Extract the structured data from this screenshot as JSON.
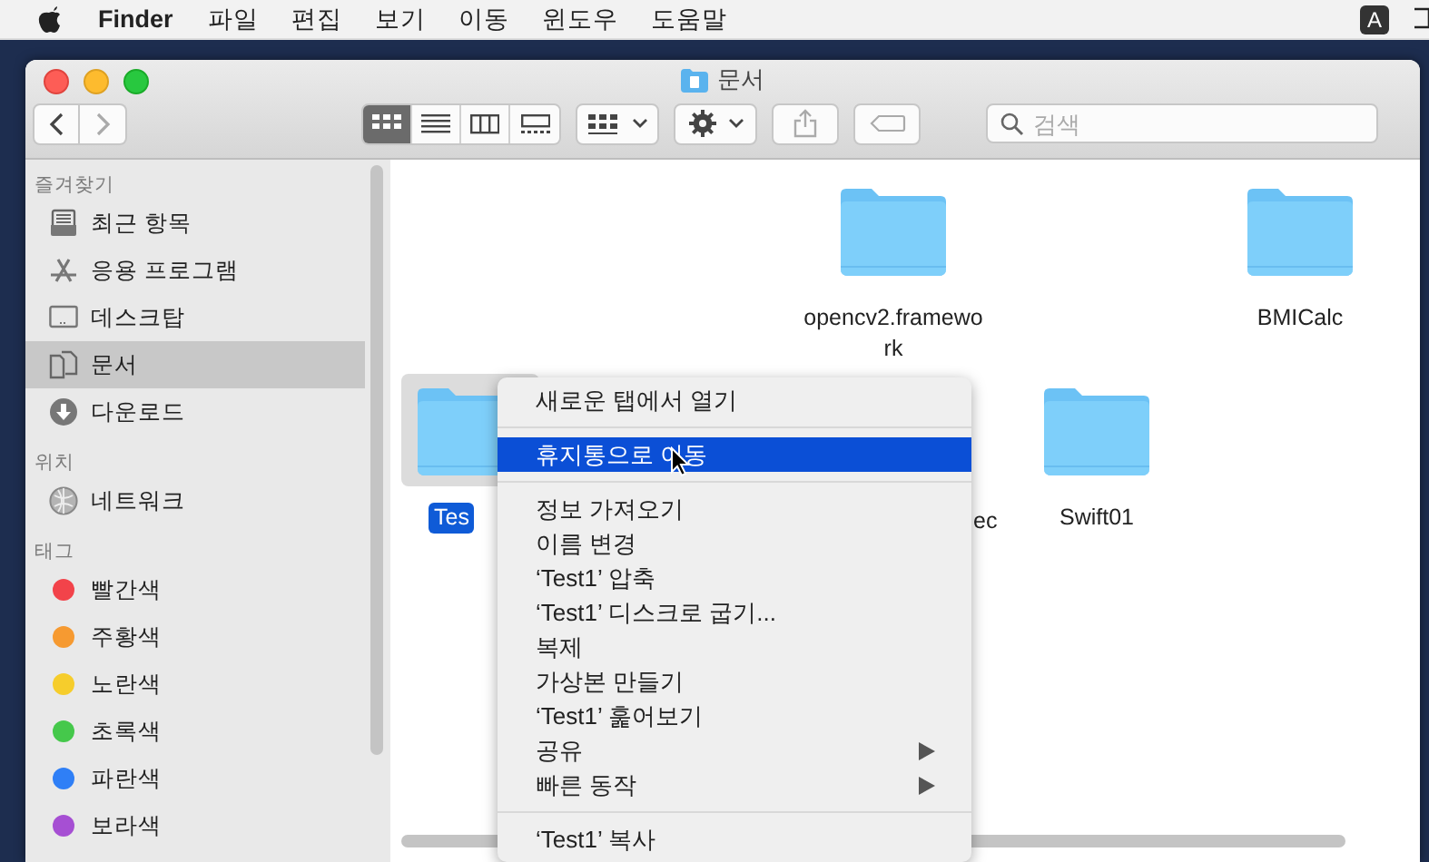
{
  "menubar": {
    "app": "Finder",
    "menus": [
      "파일",
      "편집",
      "보기",
      "이동",
      "윈도우",
      "도움말"
    ],
    "input_source": "A"
  },
  "window": {
    "title": "문서"
  },
  "toolbar": {
    "view_modes": [
      {
        "kind": "icon",
        "selected": true
      },
      {
        "kind": "list",
        "selected": false
      },
      {
        "kind": "column",
        "selected": false
      },
      {
        "kind": "gallery",
        "selected": false
      }
    ],
    "search": {
      "placeholder": "검색"
    }
  },
  "sidebar": {
    "sections": [
      {
        "heading": "즐겨찾기",
        "items": [
          {
            "kind": "recents",
            "label": "최근 항목",
            "selected": false
          },
          {
            "kind": "apps",
            "label": "응용 프로그램",
            "selected": false
          },
          {
            "kind": "desktop",
            "label": "데스크탑",
            "selected": false
          },
          {
            "kind": "documents",
            "label": "문서",
            "selected": true
          },
          {
            "kind": "downloads",
            "label": "다운로드",
            "selected": false
          }
        ]
      },
      {
        "heading": "위치",
        "items": [
          {
            "kind": "network",
            "label": "네트워크",
            "selected": false
          }
        ]
      },
      {
        "heading": "태그",
        "items": [
          {
            "kind": "tag",
            "label": "빨간색",
            "color": "#f2434a",
            "selected": false
          },
          {
            "kind": "tag",
            "label": "주황색",
            "color": "#f69a31",
            "selected": false
          },
          {
            "kind": "tag",
            "label": "노란색",
            "color": "#f6cd2c",
            "selected": false
          },
          {
            "kind": "tag",
            "label": "초록색",
            "color": "#45c84b",
            "selected": false
          },
          {
            "kind": "tag",
            "label": "파란색",
            "color": "#2f7ff6",
            "selected": false
          },
          {
            "kind": "tag",
            "label": "보라색",
            "color": "#a64fd3",
            "selected": false
          }
        ]
      }
    ]
  },
  "files": [
    {
      "name": "opencv2.framework",
      "icon": true,
      "selected": false
    },
    {
      "name": "BMICalc",
      "icon": true,
      "selected": false
    },
    {
      "name": "Tes",
      "icon": true,
      "selected": true
    },
    {
      "name": "ec",
      "icon": false,
      "selected": false
    },
    {
      "name": "Swift01",
      "icon": true,
      "selected": false
    }
  ],
  "context_menu": [
    {
      "kind": "item",
      "label": "새로운 탭에서 열기",
      "selected": false,
      "submenu": false
    },
    {
      "kind": "separator"
    },
    {
      "kind": "item",
      "label": "휴지통으로 이동",
      "selected": true,
      "submenu": false
    },
    {
      "kind": "separator"
    },
    {
      "kind": "item",
      "label": "정보 가져오기",
      "selected": false,
      "submenu": false
    },
    {
      "kind": "item",
      "label": "이름 변경",
      "selected": false,
      "submenu": false
    },
    {
      "kind": "item",
      "label": "‘Test1’ 압축",
      "selected": false,
      "submenu": false
    },
    {
      "kind": "item",
      "label": "‘Test1’ 디스크로 굽기...",
      "selected": false,
      "submenu": false
    },
    {
      "kind": "item",
      "label": "복제",
      "selected": false,
      "submenu": false
    },
    {
      "kind": "item",
      "label": "가상본 만들기",
      "selected": false,
      "submenu": false
    },
    {
      "kind": "item",
      "label": "‘Test1’ 훑어보기",
      "selected": false,
      "submenu": false
    },
    {
      "kind": "item",
      "label": "공유",
      "selected": false,
      "submenu": true
    },
    {
      "kind": "item",
      "label": "빠른 동작",
      "selected": false,
      "submenu": true
    },
    {
      "kind": "separator"
    },
    {
      "kind": "item",
      "label": "‘Test1’ 복사",
      "selected": false,
      "submenu": false
    }
  ]
}
